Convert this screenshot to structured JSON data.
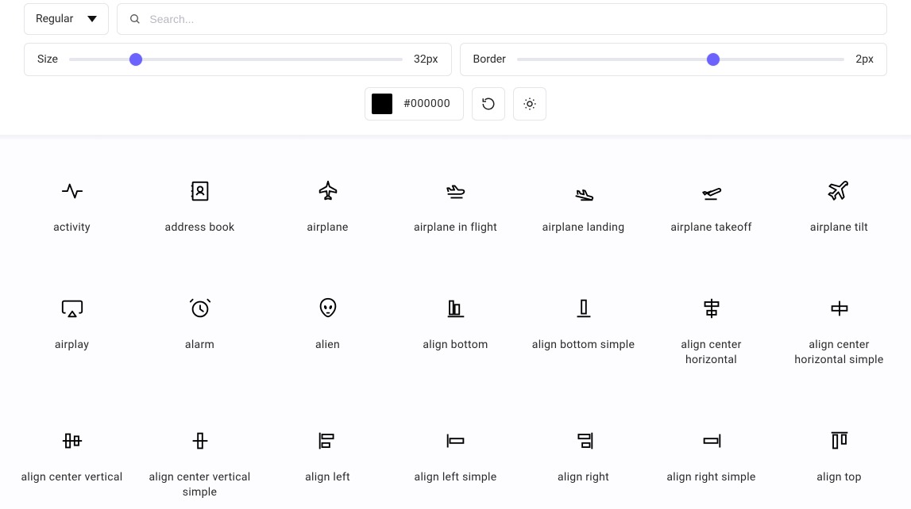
{
  "toolbar": {
    "style_dropdown": "Regular",
    "search_placeholder": "Search...",
    "size_label": "Size",
    "size_value": "32px",
    "size_pct": 20,
    "border_label": "Border",
    "border_value": "2px",
    "border_pct": 60,
    "color_hex": "#000000"
  },
  "icons": [
    {
      "name": "activity",
      "label": "activity"
    },
    {
      "name": "address-book",
      "label": "address book"
    },
    {
      "name": "airplane",
      "label": "airplane"
    },
    {
      "name": "airplane-in-flight",
      "label": "airplane in flight"
    },
    {
      "name": "airplane-landing",
      "label": "airplane landing"
    },
    {
      "name": "airplane-takeoff",
      "label": "airplane takeoff"
    },
    {
      "name": "airplane-tilt",
      "label": "airplane tilt"
    },
    {
      "name": "airplay",
      "label": "airplay"
    },
    {
      "name": "alarm",
      "label": "alarm"
    },
    {
      "name": "alien",
      "label": "alien"
    },
    {
      "name": "align-bottom",
      "label": "align bottom"
    },
    {
      "name": "align-bottom-simple",
      "label": "align bottom simple"
    },
    {
      "name": "align-center-horizontal",
      "label": "align center horizontal"
    },
    {
      "name": "align-center-horizontal-simple",
      "label": "align center horizontal simple"
    },
    {
      "name": "align-center-vertical",
      "label": "align center vertical"
    },
    {
      "name": "align-center-vertical-simple",
      "label": "align center vertical simple"
    },
    {
      "name": "align-left",
      "label": "align left"
    },
    {
      "name": "align-left-simple",
      "label": "align left simple"
    },
    {
      "name": "align-right",
      "label": "align right"
    },
    {
      "name": "align-right-simple",
      "label": "align right simple"
    },
    {
      "name": "align-top",
      "label": "align top"
    }
  ]
}
